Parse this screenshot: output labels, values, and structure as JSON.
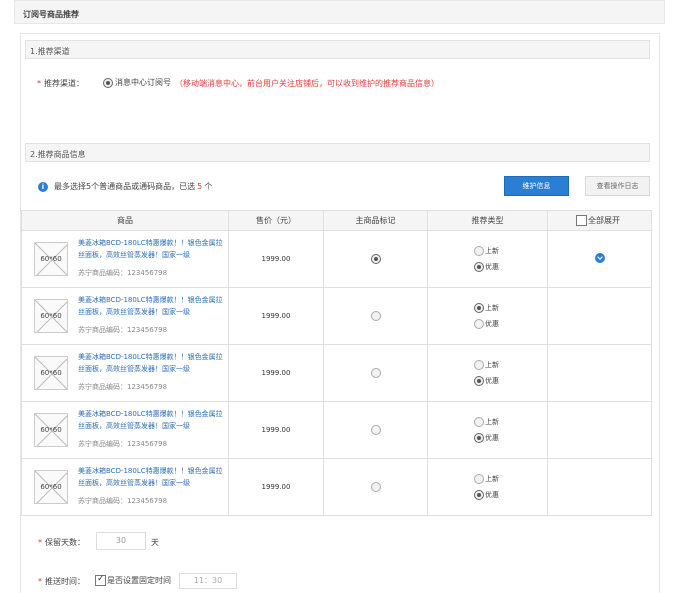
{
  "header": {
    "title": "订阅号商品推荐"
  },
  "sections": {
    "channel": "1.推荐渠道",
    "goods": "2.推荐商品信息"
  },
  "channel": {
    "required_mark": "*",
    "label": "推荐渠道：",
    "option_label": "消息中心订阅号",
    "hint": "（移动端消息中心，前台用户关注店铺后，可以收到维护的推荐商品信息）"
  },
  "goods_info": {
    "info_prefix": "最多选择5个普通商品或通码商品，已选",
    "selected_count": "5",
    "info_suffix": "个",
    "maintain_button": "维护信息",
    "log_button": "查看操作日志"
  },
  "table": {
    "headers": {
      "goods": "商品",
      "price": "售价（元）",
      "main_mark": "主商品标记",
      "type": "推荐类型",
      "expand": "全部展开"
    },
    "type_labels": {
      "new": "上新",
      "discount": "优惠"
    },
    "rows": [
      {
        "thumb": "60*60",
        "name": "美菱冰箱BCD-180LC特惠爆款！！银色金属拉丝面板，高效丝管蒸发器！国家一级",
        "code": "苏宁商品编码：123456798",
        "price": "1999.00",
        "main": true,
        "type": "discount",
        "expanded": true
      },
      {
        "thumb": "60*60",
        "name": "美菱冰箱BCD-180LC特惠爆款！！银色金属拉丝面板，高效丝管蒸发器！国家一级",
        "code": "苏宁商品编码：123456798",
        "price": "1999.00",
        "main": false,
        "type": "new",
        "expanded": false
      },
      {
        "thumb": "60*60",
        "name": "美菱冰箱BCD-180LC特惠爆款！！银色金属拉丝面板，高效丝管蒸发器！国家一级",
        "code": "苏宁商品编码：123456798",
        "price": "1999.00",
        "main": false,
        "type": "discount",
        "expanded": false
      },
      {
        "thumb": "60*60",
        "name": "美菱冰箱BCD-180LC特惠爆款！！银色金属拉丝面板，高效丝管蒸发器！国家一级",
        "code": "苏宁商品编码：123456798",
        "price": "1999.00",
        "main": false,
        "type": "discount",
        "expanded": false
      },
      {
        "thumb": "60*60",
        "name": "美菱冰箱BCD-180LC特惠爆款！！银色金属拉丝面板，高效丝管蒸发器！国家一级",
        "code": "苏宁商品编码：123456798",
        "price": "1999.00",
        "main": false,
        "type": "discount",
        "expanded": false
      }
    ]
  },
  "keep": {
    "required_mark": "*",
    "label": "保留天数：",
    "value": "30",
    "unit": "天"
  },
  "push": {
    "required_mark": "*",
    "label": "推送时间：",
    "checkbox_label": "是否设置固定时间",
    "time": "11：30"
  },
  "colors": {
    "accent": "#2a7fd4",
    "required": "#e4393c",
    "link": "#2a6ebb"
  }
}
